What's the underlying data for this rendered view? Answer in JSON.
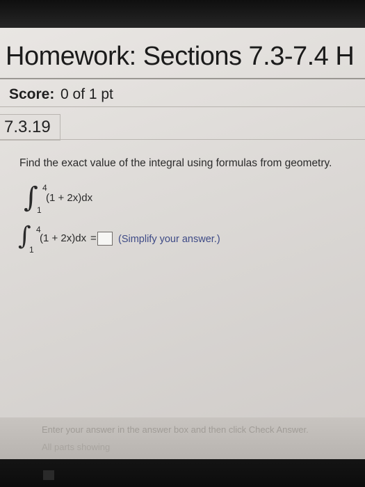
{
  "header": {
    "title": "Homework: Sections 7.3-7.4 H"
  },
  "score": {
    "label": "Score:",
    "value": "0 of 1 pt"
  },
  "section": {
    "number": "7.3.19"
  },
  "problem": {
    "instruction": "Find the exact value of the integral using formulas from geometry.",
    "integral": {
      "sign": "∫",
      "upper": "4",
      "lower": "1",
      "integrand": "(1 + 2x)dx"
    },
    "answer_line": {
      "sign": "∫",
      "upper": "4",
      "lower": "1",
      "integrand": "(1 + 2x)dx",
      "equals": "=",
      "answer_value": "",
      "hint": "(Simplify your answer.)"
    }
  },
  "footer": {
    "line1": "Enter your answer in the answer box and then click Check Answer.",
    "line2": "All parts showing"
  }
}
